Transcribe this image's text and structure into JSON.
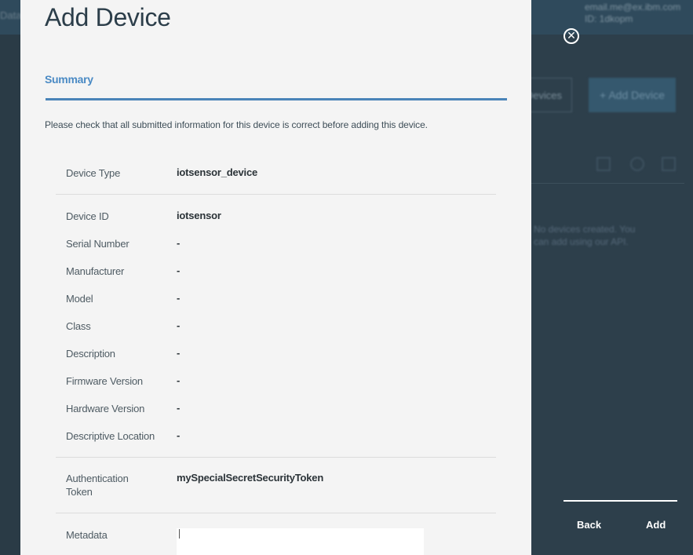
{
  "background": {
    "user_email": "email.me@ex.ibm.com",
    "user_org": "ID: 1dkopm",
    "left_text": "Data",
    "outline_button": "Devices",
    "primary_button": "+ Add Device",
    "info_line1": "No devices created. You",
    "info_line2": "can add using our API."
  },
  "modal": {
    "title": "Add Device",
    "tab": "Summary",
    "intro": "Please check that all submitted information for this device is correct before adding this device.",
    "rows": [
      {
        "label": "Device Type",
        "value": "iotsensor_device"
      },
      {
        "label": "Device ID",
        "value": "iotsensor"
      },
      {
        "label": "Serial Number",
        "value": "-"
      },
      {
        "label": "Manufacturer",
        "value": "-"
      },
      {
        "label": "Model",
        "value": "-"
      },
      {
        "label": "Class",
        "value": "-"
      },
      {
        "label": "Description",
        "value": "-"
      },
      {
        "label": "Firmware Version",
        "value": "-"
      },
      {
        "label": "Hardware Version",
        "value": "-"
      },
      {
        "label": "Descriptive Location",
        "value": "-"
      },
      {
        "label": "Authentication Token",
        "value": "mySpecialSecretSecurityToken"
      },
      {
        "label": "Metadata",
        "value": ""
      }
    ]
  },
  "controls": {
    "close_symbol": "✕",
    "back_label": "Back",
    "add_label": "Add"
  },
  "icons": {
    "close": "close-icon",
    "bg_icons": [
      "tag-icon",
      "search-icon",
      "trash-icon"
    ]
  },
  "colors": {
    "accent": "#4a84b8",
    "overlay": "#2a3b46",
    "modal": "#f4f4f4"
  }
}
